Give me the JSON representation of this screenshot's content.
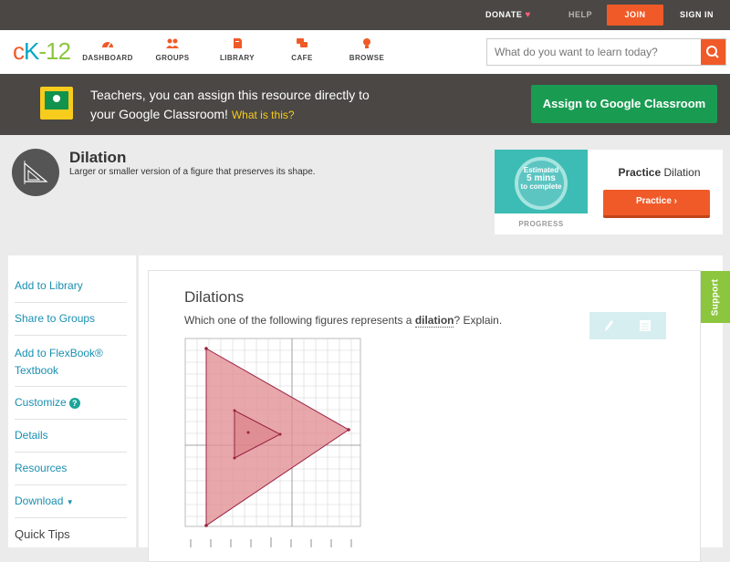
{
  "topbar": {
    "donate": "DONATE",
    "help": "HELP",
    "join": "JOIN",
    "signin": "SIGN IN"
  },
  "nav": {
    "logo": {
      "c": "c",
      "k": "K",
      "rest": "-12"
    },
    "items": [
      {
        "label": "DASHBOARD",
        "icon": "speedometer-icon"
      },
      {
        "label": "GROUPS",
        "icon": "groups-icon"
      },
      {
        "label": "LIBRARY",
        "icon": "library-icon"
      },
      {
        "label": "CAFE",
        "icon": "chat-icon"
      },
      {
        "label": "BROWSE",
        "icon": "lightbulb-icon"
      }
    ],
    "search_placeholder": "What do you want to learn today?"
  },
  "banner": {
    "line1": "Teachers, you can assign this resource directly to",
    "line2": "your Google Classroom!",
    "link": "What is this?",
    "assign_button": "Assign to Google Classroom"
  },
  "concept": {
    "title": "Dilation",
    "subtitle": "Larger or smaller version of a figure that preserves its shape."
  },
  "practice": {
    "estimated": "Estimated",
    "mins": "5 mins",
    "to_complete": "to complete",
    "progress_label": "PROGRESS",
    "title_bold": "Practice",
    "title_rest": "Dilation",
    "button": "Practice"
  },
  "sidebar": {
    "items": [
      {
        "label": "Add to Library"
      },
      {
        "label": "Share to Groups"
      },
      {
        "label": "Add to FlexBook® Textbook"
      },
      {
        "label": "Customize"
      },
      {
        "label": "Details"
      },
      {
        "label": "Resources"
      },
      {
        "label": "Download"
      }
    ],
    "quick_tips": "Quick Tips"
  },
  "main": {
    "title": "Dilations",
    "question_pre": "Which one of the following figures represents a",
    "question_term": "dilation",
    "question_post": "? Explain."
  },
  "support": "Support",
  "colors": {
    "accent": "#f05a28",
    "google_green": "#1a9b52",
    "link_blue": "#1a8fb0",
    "support_green": "#8cc63e"
  }
}
